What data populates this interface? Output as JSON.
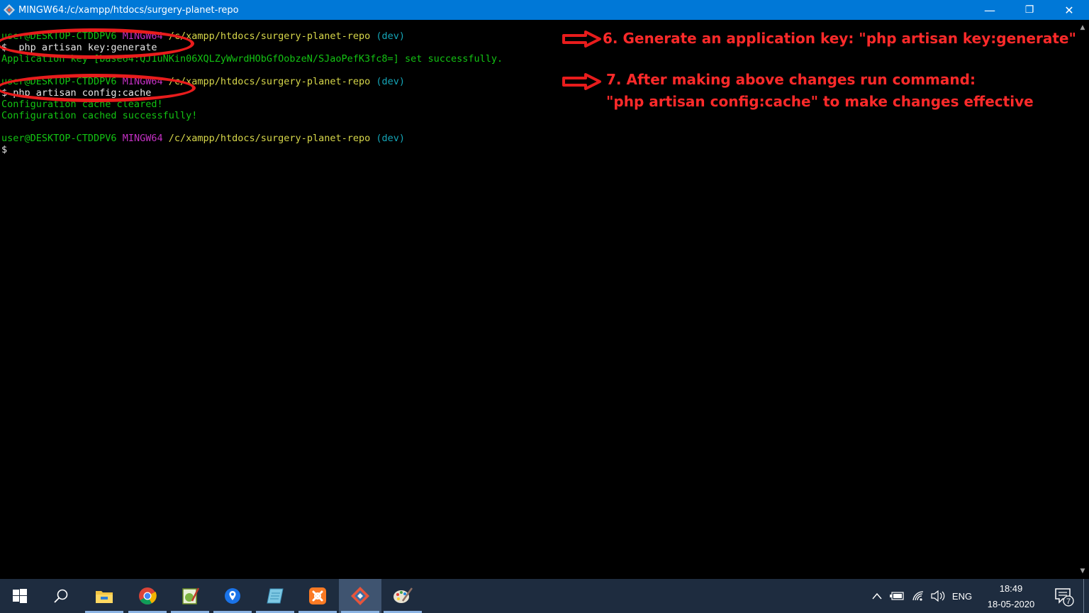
{
  "window": {
    "title": "MINGW64:/c/xampp/htdocs/surgery-planet-repo",
    "minimize_glyph": "—",
    "restore_glyph": "❐",
    "close_glyph": "✕"
  },
  "terminal": {
    "lines": [
      {
        "user": "user@DESKTOP-CTDDPV6",
        "shell": "MINGW64",
        "path": "/c/xampp/htdocs/surgery-planet-repo",
        "branch": "(dev)"
      },
      {
        "command": "$  php artisan key:generate"
      },
      {
        "output": "Application key [base64:QJ1uNKin06XQLZyWwrdHObGfOobzeN/SJaoPefK3fc8=] set successfully."
      },
      {
        "user": "user@DESKTOP-CTDDPV6",
        "shell": "MINGW64",
        "path": "/c/xampp/htdocs/surgery-planet-repo",
        "branch": "(dev)"
      },
      {
        "command": "$ php artisan config:cache"
      },
      {
        "output": "Configuration cache cleared!"
      },
      {
        "output": "Configuration cached successfully!"
      },
      {
        "user": "user@DESKTOP-CTDDPV6",
        "shell": "MINGW64",
        "path": "/c/xampp/htdocs/surgery-planet-repo",
        "branch": "(dev)"
      },
      {
        "command": "$"
      }
    ]
  },
  "annotations": {
    "step6": "6. Generate an application key: \"php artisan key:generate\"",
    "step7_line1": "7. After making above changes run command:",
    "step7_line2": "\"php artisan config:cache\"  to make changes effective"
  },
  "taskbar": {
    "apps": [
      "start-icon",
      "search-icon",
      "file-explorer-icon",
      "chrome-icon",
      "notepad-plus-plus-icon",
      "maps-icon",
      "notes-icon",
      "xampp-icon",
      "git-bash-icon",
      "paint-icon"
    ],
    "language": "ENG",
    "time": "18:49",
    "date": "18-05-2020",
    "notification_count": "7"
  },
  "colors": {
    "titlebar": "#0078d7",
    "annotation": "#ff2a2a",
    "taskbar": "#1e2c3f",
    "term_green": "#13c313",
    "term_magenta": "#c330c3",
    "term_yellow": "#d7d74a",
    "term_cyan": "#15a6b8"
  }
}
